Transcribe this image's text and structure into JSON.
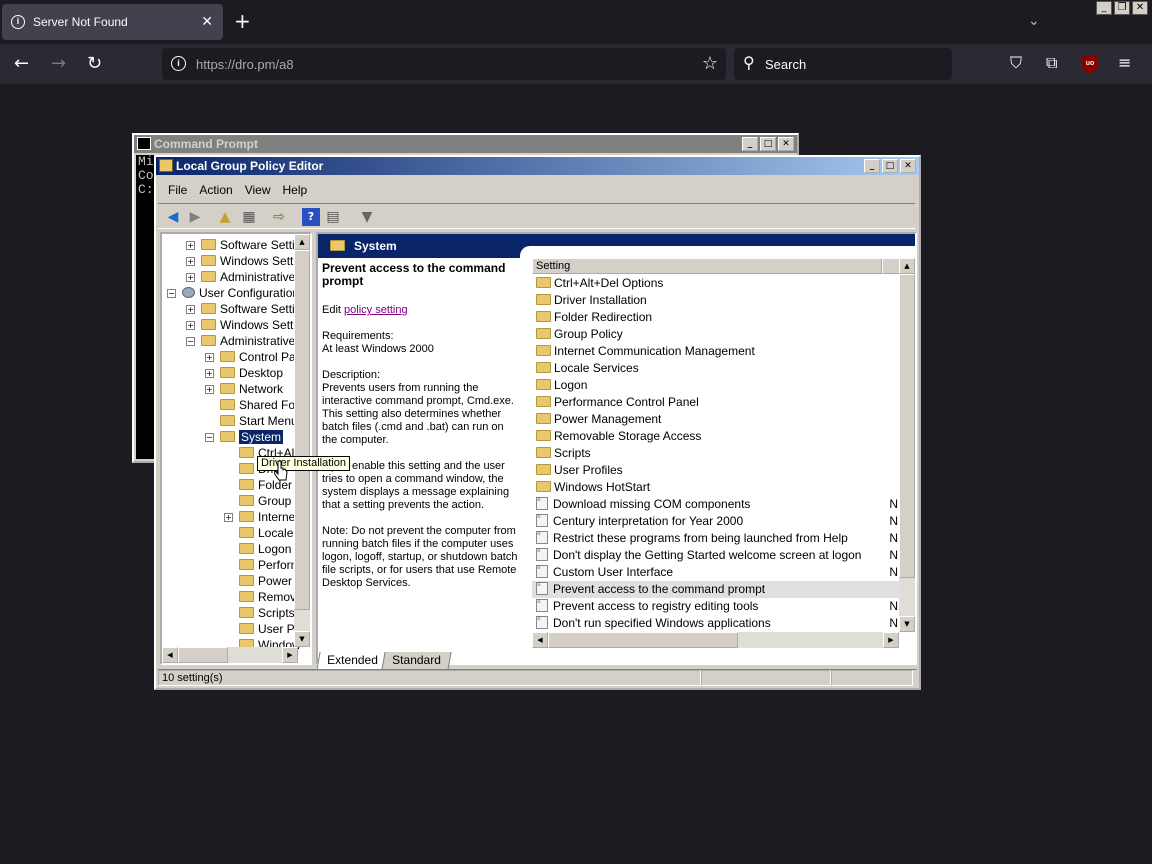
{
  "browser": {
    "tab_title": "Server Not Found",
    "tab_close": "✕",
    "new_tab": "+",
    "url": "https://dro.pm/a8",
    "search_placeholder": "Search"
  },
  "cmd": {
    "title": "Command Prompt",
    "lines": [
      "Mi",
      "Co",
      "",
      "C:"
    ]
  },
  "gpe": {
    "title": "Local Group Policy Editor",
    "menu": [
      "File",
      "Action",
      "View",
      "Help"
    ],
    "tree": [
      {
        "label": "Software Settin",
        "exp": "+",
        "indent": 2,
        "icon": "folder"
      },
      {
        "label": "Windows Settin",
        "exp": "+",
        "indent": 2,
        "icon": "folder"
      },
      {
        "label": "Administrative T",
        "exp": "+",
        "indent": 2,
        "icon": "folder"
      },
      {
        "label": "User Configuration",
        "exp": "−",
        "indent": 1,
        "icon": "user"
      },
      {
        "label": "Software Settin",
        "exp": "+",
        "indent": 2,
        "icon": "folder"
      },
      {
        "label": "Windows Settin",
        "exp": "+",
        "indent": 2,
        "icon": "folder"
      },
      {
        "label": "Administrative T",
        "exp": "−",
        "indent": 2,
        "icon": "folder"
      },
      {
        "label": "Control Pan",
        "exp": "+",
        "indent": 3,
        "icon": "folder"
      },
      {
        "label": "Desktop",
        "exp": "+",
        "indent": 3,
        "icon": "folder"
      },
      {
        "label": "Network",
        "exp": "+",
        "indent": 3,
        "icon": "folder"
      },
      {
        "label": "Shared Folc",
        "exp": "",
        "indent": 3,
        "icon": "folder"
      },
      {
        "label": "Start Menu",
        "exp": "",
        "indent": 3,
        "icon": "folder"
      },
      {
        "label": "System",
        "exp": "−",
        "indent": 3,
        "icon": "folder",
        "selected": true
      },
      {
        "label": "Ctrl+Alt",
        "exp": "",
        "indent": 4,
        "icon": "folder"
      },
      {
        "label": "Driv",
        "exp": "",
        "indent": 4,
        "icon": "folder"
      },
      {
        "label": "Folder F",
        "exp": "",
        "indent": 4,
        "icon": "folder"
      },
      {
        "label": "Group P",
        "exp": "",
        "indent": 4,
        "icon": "folder"
      },
      {
        "label": "Interne",
        "exp": "+",
        "indent": 4,
        "icon": "folder"
      },
      {
        "label": "Locale S",
        "exp": "",
        "indent": 4,
        "icon": "folder"
      },
      {
        "label": "Logon",
        "exp": "",
        "indent": 4,
        "icon": "folder"
      },
      {
        "label": "Perform",
        "exp": "",
        "indent": 4,
        "icon": "folder"
      },
      {
        "label": "Power N",
        "exp": "",
        "indent": 4,
        "icon": "folder"
      },
      {
        "label": "Remova",
        "exp": "",
        "indent": 4,
        "icon": "folder"
      },
      {
        "label": "Scripts",
        "exp": "",
        "indent": 4,
        "icon": "folder"
      },
      {
        "label": "User Pr",
        "exp": "",
        "indent": 4,
        "icon": "folder"
      },
      {
        "label": "Window",
        "exp": "",
        "indent": 4,
        "icon": "folder"
      }
    ],
    "pane_title": "System",
    "desc": {
      "title": "Prevent access to the command prompt",
      "edit_prefix": "Edit ",
      "edit_link": "policy setting ",
      "requirements_label": "Requirements:",
      "requirements": "At least Windows 2000",
      "description_label": "Description:",
      "description": "Prevents users from running the interactive command prompt, Cmd.exe. This setting also determines whether batch files (.cmd and .bat) can run on the computer.",
      "enable_text": "If you enable this setting and the user tries to open a command window, the system displays a message explaining that a setting prevents the action.",
      "note": "Note: Do not prevent the computer from running batch files if the computer uses logon, logoff, startup, or shutdown batch file scripts, or for users that use Remote Desktop Services."
    },
    "list_header": "Setting",
    "list_items": [
      {
        "label": "Ctrl+Alt+Del Options",
        "type": "folder",
        "extra": ""
      },
      {
        "label": "Driver Installation",
        "type": "folder",
        "extra": ""
      },
      {
        "label": "Folder Redirection",
        "type": "folder",
        "extra": ""
      },
      {
        "label": "Group Policy",
        "type": "folder",
        "extra": ""
      },
      {
        "label": "Internet Communication Management",
        "type": "folder",
        "extra": ""
      },
      {
        "label": "Locale Services",
        "type": "folder",
        "extra": ""
      },
      {
        "label": "Logon",
        "type": "folder",
        "extra": ""
      },
      {
        "label": "Performance Control Panel",
        "type": "folder",
        "extra": ""
      },
      {
        "label": "Power Management",
        "type": "folder",
        "extra": ""
      },
      {
        "label": "Removable Storage Access",
        "type": "folder",
        "extra": ""
      },
      {
        "label": "Scripts",
        "type": "folder",
        "extra": ""
      },
      {
        "label": "User Profiles",
        "type": "folder",
        "extra": ""
      },
      {
        "label": "Windows HotStart",
        "type": "folder",
        "extra": ""
      },
      {
        "label": "Download missing COM components",
        "type": "policy",
        "extra": "N"
      },
      {
        "label": "Century interpretation for Year 2000",
        "type": "policy",
        "extra": "N"
      },
      {
        "label": "Restrict these programs from being launched from Help",
        "type": "policy",
        "extra": "N"
      },
      {
        "label": "Don't display the Getting Started welcome screen at logon",
        "type": "policy",
        "extra": "N"
      },
      {
        "label": "Custom User Interface",
        "type": "policy",
        "extra": "N"
      },
      {
        "label": "Prevent access to the command prompt",
        "type": "policy",
        "extra": "",
        "highlight": true
      },
      {
        "label": "Prevent access to registry editing tools",
        "type": "policy",
        "extra": "N"
      },
      {
        "label": "Don't run specified Windows applications",
        "type": "policy",
        "extra": "N"
      }
    ],
    "tabs": [
      "Extended",
      "Standard"
    ],
    "status": "10 setting(s)",
    "tooltip": "Driver Installation"
  }
}
